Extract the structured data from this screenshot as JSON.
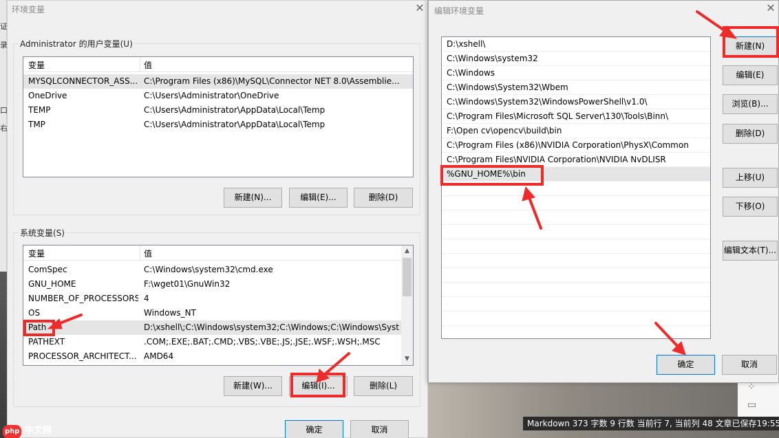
{
  "background": {
    "left_fragments": [
      "证",
      "录",
      "口",
      "右"
    ],
    "statusbar": "Markdown   373 字数   9 行数   当前行 7, 当前列 48   文章已保存19:55",
    "watermark": "中文网",
    "watermark_badge": "php"
  },
  "env_dialog": {
    "title": "环境变量",
    "user_group_label": "Administrator 的用户变量(U)",
    "columns": [
      "变量",
      "值"
    ],
    "user_vars": [
      {
        "name": "MYSQLCONNECTOR_ASS...",
        "value": "C:\\Program Files (x86)\\MySQL\\Connector NET 8.0\\Assemblie..."
      },
      {
        "name": "OneDrive",
        "value": "C:\\Users\\Administrator\\OneDrive"
      },
      {
        "name": "TEMP",
        "value": "C:\\Users\\Administrator\\AppData\\Local\\Temp"
      },
      {
        "name": "TMP",
        "value": "C:\\Users\\Administrator\\AppData\\Local\\Temp"
      }
    ],
    "user_buttons": {
      "new": "新建(N)...",
      "edit": "编辑(E)...",
      "delete": "删除(D)"
    },
    "system_group_label": "系统变量(S)",
    "system_vars": [
      {
        "name": "ComSpec",
        "value": "C:\\Windows\\system32\\cmd.exe"
      },
      {
        "name": "GNU_HOME",
        "value": "F:\\wget01\\GnuWin32"
      },
      {
        "name": "NUMBER_OF_PROCESSORS",
        "value": "4"
      },
      {
        "name": "OS",
        "value": "Windows_NT"
      },
      {
        "name": "Path",
        "value": "D:\\xshell\\;C:\\Windows\\system32;C:\\Windows;C:\\Windows\\Syst..."
      },
      {
        "name": "PATHEXT",
        "value": ".COM;.EXE;.BAT;.CMD;.VBS;.VBE;.JS;.JSE;.WSF;.WSH;.MSC"
      },
      {
        "name": "PROCESSOR_ARCHITECT...",
        "value": "AMD64"
      }
    ],
    "system_buttons": {
      "new": "新建(W)...",
      "edit": "编辑(I)...",
      "delete": "删除(L)"
    },
    "ok": "确定",
    "cancel": "取消"
  },
  "edit_dialog": {
    "title": "编辑环境变量",
    "paths": [
      "D:\\xshell\\",
      "C:\\Windows\\system32",
      "C:\\Windows",
      "C:\\Windows\\System32\\Wbem",
      "C:\\Windows\\System32\\WindowsPowerShell\\v1.0\\",
      "C:\\Program Files\\Microsoft SQL Server\\130\\Tools\\Binn\\",
      "F:\\Open cv\\opencv\\build\\bin",
      "C:\\Program Files (x86)\\NVIDIA Corporation\\PhysX\\Common",
      "C:\\Program Files\\NVIDIA Corporation\\NVIDIA NvDLISR",
      "%GNU_HOME%\\bin"
    ],
    "buttons": {
      "new": "新建(N)",
      "edit": "编辑(E)",
      "browse": "浏览(B)...",
      "delete": "删除(D)",
      "up": "上移(U)",
      "down": "下移(O)",
      "edit_text": "编辑文本(T)..."
    },
    "ok": "确定",
    "cancel": "取消"
  },
  "annotation_color": "#ee2b2b"
}
